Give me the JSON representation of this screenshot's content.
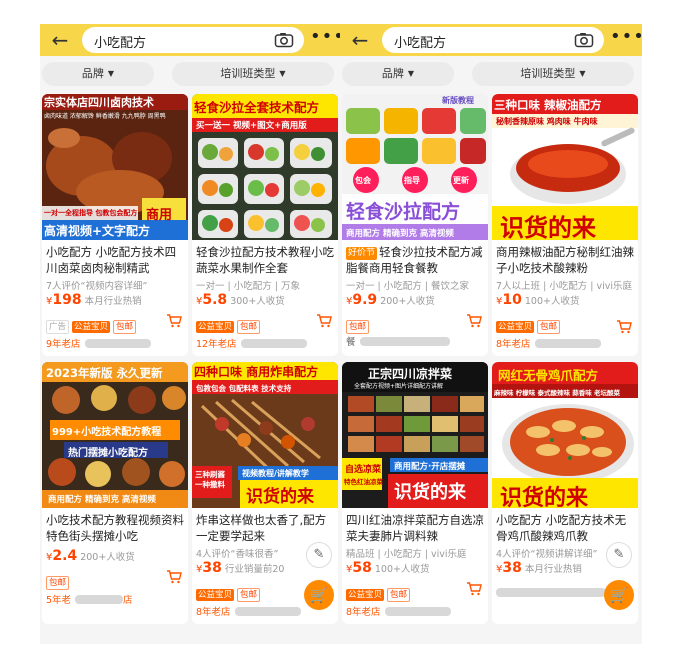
{
  "panels": [
    {
      "search_query": "小吃配方",
      "filters": [
        "品牌",
        "培训班类型"
      ],
      "cards": [
        {
          "title": "小吃配方 小吃配方技术四川卤菜卤肉秘制精武",
          "thumb": {
            "top": "宗实体店四川卤肉技术",
            "sub": "卤肉味道 浓郁解馋 鲜香嫩滑 九九鸭脖 周黑鸭",
            "bottom": "高清视频+文字配方",
            "corner": "商用",
            "badge": "一对一全程指导 包教包会配方"
          },
          "sub": "7人评价“视频内容详细”",
          "price": "198",
          "price_suffix": "本月行业热销",
          "badges": [
            "广告",
            "公益宝贝",
            "包邮"
          ],
          "store": "9年老店"
        },
        {
          "title": "轻食沙拉配方技术教程小吃 蔬菜水果制作全套",
          "thumb": {
            "top": "轻食沙拉全套技术配方",
            "sub": "买一送一 视频+图文+商用版"
          },
          "sub": "一对一 | 小吃配方 | 万象",
          "price": "5.8",
          "price_suffix": "300+人收货",
          "badges": [
            "公益宝贝",
            "包邮"
          ],
          "store": "12年老店"
        },
        {
          "title": "小吃技术配方教程视频资料特色街头摆摊小吃",
          "thumb": {
            "top": "2023年新版 永久更新",
            "mid1": "999+小吃技术配方教程",
            "mid2": "热门摆摊小吃配方",
            "bottom": "商用配方 精确到克 高清视频"
          },
          "sub": "",
          "price": "2.4",
          "price_suffix": "200+人收货",
          "badges": [
            "包邮"
          ],
          "store": "5年老",
          "store_tail": "店"
        },
        {
          "title": "炸串这样做也太香了,配方一定要学起来",
          "thumb": {
            "top": "四种口味 商用炸串配方",
            "sub": "包教包会 包配料表 技术支持",
            "bottom": "识货的来",
            "side": "三种刷酱 一种撒料",
            "tag": "视频教程/讲解教学"
          },
          "sub": "4人评价“香味很香”",
          "price": "38",
          "price_suffix": "行业销量前20",
          "badges": [
            "公益宝贝",
            "包邮"
          ],
          "store": "8年老店"
        }
      ]
    },
    {
      "search_query": "小吃配方",
      "filters": [
        "品牌",
        "培训班类型"
      ],
      "cards": [
        {
          "title": "轻食沙拉技术配方减脂餐商用轻食餐教",
          "hot_tag": "好价节",
          "thumb": {
            "top": "新版教程",
            "chips": [
              "包会",
              "指导",
              "更新"
            ],
            "bottom": "轻食沙拉配方",
            "sub": "商用配方 精确到克 高清视频"
          },
          "sub": "一对一 | 小吃配方 | 餐饮之家",
          "price": "9.9",
          "price_suffix": "200+人收货",
          "badges": [
            "包邮"
          ],
          "store": "餐"
        },
        {
          "title": "商用辣椒油配方秘制红油辣子小吃技术酸辣粉",
          "thumb": {
            "top": "三种口味 辣椒油配方",
            "sub": "秘制香辣原味 鸡肉味 牛肉味",
            "bottom": "识货的来"
          },
          "sub": "7人以上班 | 小吃配方 | vivi乐庭",
          "price": "10",
          "price_suffix": "100+人收货",
          "badges": [
            "公益宝贝",
            "包邮"
          ],
          "store": "8年老店"
        },
        {
          "title": "四川红油凉拌菜配方自选凉菜夫妻肺片调料辣",
          "thumb": {
            "top": "正宗四川凉拌菜",
            "sub": "全套配方视频+图片详细配方讲解",
            "side1": "自选凉菜",
            "side2": "特色红油凉菜",
            "tag": "商用配方·开店摆摊",
            "bottom": "识货的来"
          },
          "sub": "精品班 | 小吃配方 | vivi乐庭",
          "price": "58",
          "price_suffix": "100+人收货",
          "badges": [
            "公益宝贝",
            "包邮"
          ],
          "store": "8年老店"
        },
        {
          "title": "小吃配方 小吃配方技术无骨鸡爪酸辣鸡爪教",
          "thumb": {
            "top": "网红无骨鸡爪配方",
            "sub": "麻辣味 柠檬味 泰式酸辣味 蒜香味 老坛酸菜",
            "bottom": "识货的来"
          },
          "sub": "4人评价“视频讲解详细”",
          "price": "38",
          "price_suffix": "本月行业热销",
          "badges": [],
          "store": ""
        }
      ]
    }
  ],
  "icons": {
    "back": "←",
    "more": "•••",
    "caret": "▼",
    "price_symbol": "¥",
    "feedback": "✎",
    "cart": "🛒"
  },
  "colors": {
    "topbar": "#f8d649",
    "price": "#ff4400",
    "accent": "#ff6a00"
  }
}
